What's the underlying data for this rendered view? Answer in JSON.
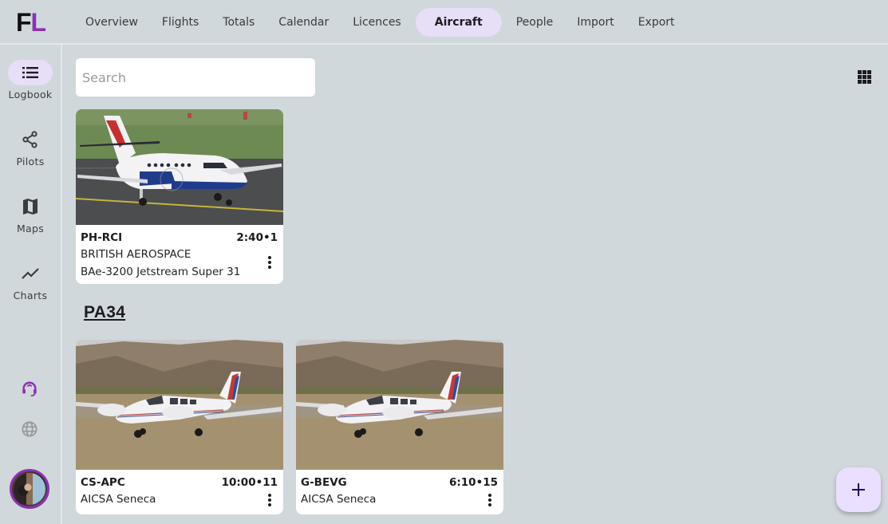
{
  "app": {
    "logo_f": "F",
    "logo_l": "L",
    "brand_color": "#8e2fb4",
    "accent_bg": "#e7def8"
  },
  "nav": {
    "items": [
      {
        "label": "Overview",
        "active": false
      },
      {
        "label": "Flights",
        "active": false
      },
      {
        "label": "Totals",
        "active": false
      },
      {
        "label": "Calendar",
        "active": false
      },
      {
        "label": "Licences",
        "active": false
      },
      {
        "label": "Aircraft",
        "active": true
      },
      {
        "label": "People",
        "active": false
      },
      {
        "label": "Import",
        "active": false
      },
      {
        "label": "Export",
        "active": false
      }
    ]
  },
  "sidebar": {
    "items": [
      {
        "label": "Logbook",
        "icon": "list-icon",
        "active": true
      },
      {
        "label": "Pilots",
        "icon": "share-icon",
        "active": false
      },
      {
        "label": "Maps",
        "icon": "map-icon",
        "active": false
      },
      {
        "label": "Charts",
        "icon": "trend-icon",
        "active": false
      }
    ],
    "support_icon": "headset-icon",
    "language_icon": "globe-icon",
    "avatar": "user-avatar"
  },
  "search": {
    "placeholder": "Search",
    "value": ""
  },
  "view_toggle_icon": "grid-view-icon",
  "ungrouped_aircraft": [
    {
      "registration": "PH-RCI",
      "time": "2:40•1",
      "manufacturer": "BRITISH AEROSPACE",
      "model": "BAe-3200 Jetstream Super 31"
    }
  ],
  "groups": [
    {
      "title": "PA34",
      "aircraft": [
        {
          "registration": "CS-APC",
          "time": "10:00•11",
          "model": "AICSA Seneca"
        },
        {
          "registration": "G-BEVG",
          "time": "6:10•15",
          "model": "AICSA Seneca"
        }
      ]
    }
  ],
  "fab": {
    "icon": "plus-icon"
  }
}
